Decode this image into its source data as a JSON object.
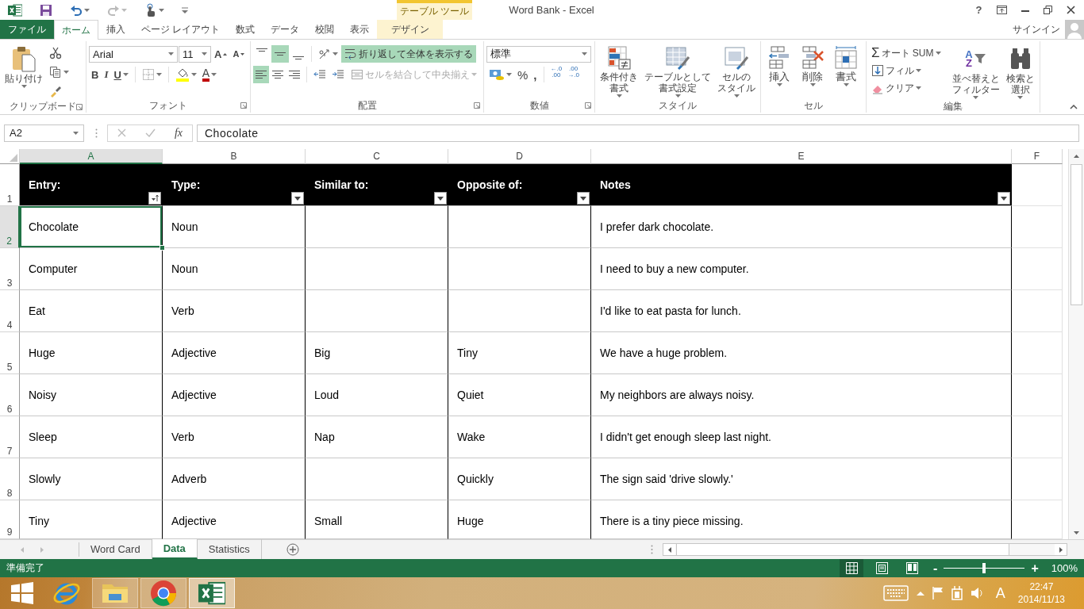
{
  "title_bar": {
    "context_group": "テーブル ツール",
    "title": "Word Bank - Excel",
    "help": "?"
  },
  "ribbon_tabs": [
    {
      "label": "ファイル",
      "kind": "file",
      "selected": false
    },
    {
      "label": "ホーム",
      "kind": "tab",
      "selected": true
    },
    {
      "label": "挿入",
      "kind": "tab",
      "selected": false
    },
    {
      "label": "ページ レイアウト",
      "kind": "tab",
      "selected": false
    },
    {
      "label": "数式",
      "kind": "tab",
      "selected": false
    },
    {
      "label": "データ",
      "kind": "tab",
      "selected": false
    },
    {
      "label": "校閲",
      "kind": "tab",
      "selected": false
    },
    {
      "label": "表示",
      "kind": "tab",
      "selected": false
    },
    {
      "label": "デザイン",
      "kind": "context",
      "selected": false
    }
  ],
  "account": {
    "sign_in": "サインイン"
  },
  "ribbon": {
    "clipboard": {
      "label": "クリップボード",
      "paste": "貼り付け"
    },
    "font": {
      "label": "フォント",
      "font_name": "Arial",
      "font_size": "11",
      "grow": "A",
      "shrink": "A",
      "bold": "B",
      "italic": "I",
      "underline": "U",
      "font_color": "A"
    },
    "alignment": {
      "label": "配置",
      "vertical": [
        {
          "selected": false
        },
        {
          "selected": true
        },
        {
          "selected": false
        }
      ],
      "horizontal": [
        {
          "selected": true
        },
        {
          "selected": false
        },
        {
          "selected": false
        }
      ],
      "wrap_text": {
        "label": "折り返して全体を表示する",
        "on": true
      },
      "merge": {
        "label": "セルを結合して中央揃え",
        "disabled": true
      }
    },
    "number": {
      "label": "数値",
      "format": "標準",
      "percent": "%",
      "comma": ",",
      "decimals": [
        {
          "top": "←.0",
          "bottom": ".00"
        },
        {
          "top": ".00",
          "bottom": "→.0"
        }
      ]
    },
    "styles": {
      "label": "スタイル",
      "buttons": [
        {
          "kind": "conditional",
          "lines": [
            "条件付き",
            "書式"
          ]
        },
        {
          "kind": "table",
          "lines": [
            "テーブルとして",
            "書式設定"
          ]
        },
        {
          "kind": "cell",
          "lines": [
            "セルの",
            "スタイル"
          ]
        }
      ]
    },
    "cells": {
      "label": "セル",
      "buttons": [
        {
          "kind": "insert",
          "label": "挿入"
        },
        {
          "kind": "delete",
          "label": "削除"
        },
        {
          "kind": "format",
          "label": "書式"
        }
      ]
    },
    "editing": {
      "label": "編集",
      "sum_sign": "Σ",
      "autosum": "オート SUM",
      "fill": "フィル",
      "clear": "クリア",
      "sort_letters": [
        "A",
        "Z"
      ],
      "sort": [
        "並べ替えと",
        "フィルター"
      ],
      "find": [
        "検索と",
        "選択"
      ]
    }
  },
  "formula_bar": {
    "name_box": "A2",
    "fx": "fx",
    "formula": "Chocolate"
  },
  "sheet": {
    "columns": [
      {
        "label": "A",
        "selected": true
      },
      {
        "label": "B",
        "selected": false
      },
      {
        "label": "C",
        "selected": false
      },
      {
        "label": "D",
        "selected": false
      },
      {
        "label": "E",
        "selected": false
      },
      {
        "label": "F",
        "selected": false
      }
    ],
    "row_numbers": [
      {
        "label": "1",
        "selected": false
      },
      {
        "label": "2",
        "selected": true
      },
      {
        "label": "3",
        "selected": false
      },
      {
        "label": "4",
        "selected": false
      },
      {
        "label": "5",
        "selected": false
      },
      {
        "label": "6",
        "selected": false
      },
      {
        "label": "7",
        "selected": false
      },
      {
        "label": "8",
        "selected": false
      },
      {
        "label": "9",
        "selected": false
      }
    ],
    "table_header": [
      {
        "text": "Entry:",
        "kind": "sorted"
      },
      {
        "text": "Type:",
        "kind": "plain"
      },
      {
        "text": "Similar to:",
        "kind": "plain"
      },
      {
        "text": "Opposite of:",
        "kind": "plain"
      },
      {
        "text": "Notes",
        "kind": "plain"
      }
    ],
    "rows": [
      {
        "cells": [
          {
            "text": "Chocolate",
            "selected": true
          },
          {
            "text": "Noun",
            "selected": false
          },
          {
            "selected": false
          },
          {
            "selected": false
          },
          {
            "text": "I prefer dark chocolate.",
            "selected": false
          }
        ]
      },
      {
        "cells": [
          {
            "text": "Computer",
            "selected": false
          },
          {
            "text": "Noun",
            "selected": false
          },
          {
            "selected": false
          },
          {
            "selected": false
          },
          {
            "text": "I need to buy a new computer.",
            "selected": false
          }
        ]
      },
      {
        "cells": [
          {
            "text": "Eat",
            "selected": false
          },
          {
            "text": "Verb",
            "selected": false
          },
          {
            "selected": false
          },
          {
            "selected": false
          },
          {
            "text": "I'd like to eat pasta for lunch.",
            "selected": false
          }
        ]
      },
      {
        "cells": [
          {
            "text": "Huge",
            "selected": false
          },
          {
            "text": "Adjective",
            "selected": false
          },
          {
            "text": "Big",
            "selected": false
          },
          {
            "text": "Tiny",
            "selected": false
          },
          {
            "text": "We have a huge problem.",
            "selected": false
          }
        ]
      },
      {
        "cells": [
          {
            "text": "Noisy",
            "selected": false
          },
          {
            "text": "Adjective",
            "selected": false
          },
          {
            "text": "Loud",
            "selected": false
          },
          {
            "text": "Quiet",
            "selected": false
          },
          {
            "text": "My neighbors are always noisy.",
            "selected": false
          }
        ]
      },
      {
        "cells": [
          {
            "text": "Sleep",
            "selected": false
          },
          {
            "text": "Verb",
            "selected": false
          },
          {
            "text": "Nap",
            "selected": false
          },
          {
            "text": "Wake",
            "selected": false
          },
          {
            "text": "I didn't get enough sleep last night.",
            "selected": false
          }
        ]
      },
      {
        "cells": [
          {
            "text": "Slowly",
            "selected": false
          },
          {
            "text": "Adverb",
            "selected": false
          },
          {
            "selected": false
          },
          {
            "text": "Quickly",
            "selected": false
          },
          {
            "text": "The sign said 'drive slowly.'",
            "selected": false
          }
        ]
      },
      {
        "cells": [
          {
            "text": "Tiny",
            "selected": false
          },
          {
            "text": "Adjective",
            "selected": false
          },
          {
            "text": "Small",
            "selected": false
          },
          {
            "text": "Huge",
            "selected": false
          },
          {
            "text": "There is a tiny piece missing.",
            "selected": false
          }
        ]
      }
    ]
  },
  "sheet_tabs": [
    {
      "label": "Word Card",
      "selected": false
    },
    {
      "label": "Data",
      "selected": true
    },
    {
      "label": "Statistics",
      "selected": false
    }
  ],
  "status_bar": {
    "status": "準備完了",
    "views": [
      {
        "kind": "normal",
        "selected": true
      },
      {
        "kind": "layout",
        "selected": false
      },
      {
        "kind": "pagebreak",
        "selected": false
      }
    ],
    "zoom_out": "-",
    "zoom_slider": {
      "level": 0.5
    },
    "zoom_in": "+",
    "zoom": "100%"
  },
  "taskbar": {
    "apps": [
      {
        "kind": "orbit",
        "running": false,
        "selected": false
      },
      {
        "kind": "folder",
        "running": true,
        "selected": false
      },
      {
        "kind": "ring",
        "running": true,
        "selected": false
      },
      {
        "kind": "spreadsheet",
        "running": true,
        "selected": true
      }
    ],
    "ime": "A",
    "time": "22:47",
    "date": "2014/11/13"
  }
}
